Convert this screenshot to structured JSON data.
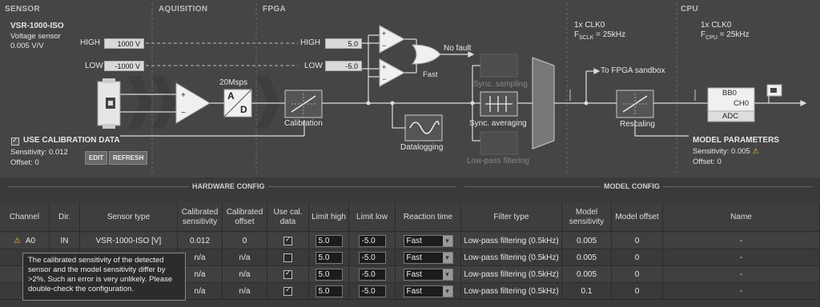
{
  "sections": {
    "sensor": "SENSOR",
    "acquisition": "AQUISITION",
    "fpga": "FPGA",
    "cpu": "CPU"
  },
  "sensor": {
    "name": "VSR-1000-ISO",
    "type": "Voltage sensor",
    "gain": "0.005 V/V",
    "high_label": "HIGH",
    "high_value": "1000 V",
    "low_label": "LOW",
    "low_value": "-1000 V"
  },
  "calibration": {
    "label": "USE CALIBRATION DATA",
    "sensitivity": "Sensitivity: 0.012",
    "offset": "Offset: 0",
    "edit": "EDIT",
    "refresh": "REFRESH"
  },
  "acq": {
    "rate": "20Msps",
    "adc_a": "A",
    "adc_d": "D"
  },
  "fpga": {
    "high_label": "HIGH",
    "high_value": "5.0",
    "low_label": "LOW",
    "low_value": "-5.0",
    "no_fault": "No fault",
    "fast": "Fast",
    "calibration": "Calibration",
    "datalogging": "Datalogging",
    "sync_sampling": "Sync. sampling",
    "sync_averaging": "Sync. averaging",
    "lowpass": "Low-pass filtering",
    "clk": "1x CLK0",
    "fs": "F",
    "fs_sub": "SCLK",
    "fs_val": " = 25kHz",
    "to_sandbox": "To FPGA sandbox",
    "rescaling": "Rescaling"
  },
  "cpu": {
    "clk": "1x CLK0",
    "f": "F",
    "f_sub": "CPU",
    "f_val": " = 25kHz",
    "bb": "BB0",
    "ch": "CH0",
    "adc": "ADC"
  },
  "model": {
    "label": "MODEL PARAMETERS",
    "sensitivity": "Sensitivity: 0.005",
    "offset": "Offset: 0"
  },
  "config": {
    "hardware": "HARDWARE CONFIG",
    "model": "MODEL CONFIG"
  },
  "table": {
    "headers": [
      "Channel",
      "Dir.",
      "Sensor type",
      "Calibrated sensitivity",
      "Calibrated offset",
      "Use cal. data",
      "Limit high",
      "Limit low",
      "Reaction time",
      "Filter type",
      "Model sensitivity",
      "Model offset",
      "Name"
    ],
    "rows": [
      {
        "channel": "A0",
        "dir": "IN",
        "sensor": "VSR-1000-ISO [V]",
        "cal_sens": "0.012",
        "cal_off": "0",
        "use_cal": true,
        "lim_high": "5.0",
        "lim_low": "-5.0",
        "reaction": "Fast",
        "filter": "Low-pass filtering (0.5kHz)",
        "model_sens": "0.005",
        "model_off": "0",
        "name": "-"
      },
      {
        "channel": "",
        "dir": "",
        "sensor": "",
        "cal_sens": "n/a",
        "cal_off": "n/a",
        "use_cal": false,
        "lim_high": "5.0",
        "lim_low": "-5.0",
        "reaction": "Fast",
        "filter": "Low-pass filtering (0.5kHz)",
        "model_sens": "0.005",
        "model_off": "0",
        "name": "-"
      },
      {
        "channel": "",
        "dir": "",
        "sensor": "",
        "cal_sens": "n/a",
        "cal_off": "n/a",
        "use_cal": true,
        "lim_high": "5.0",
        "lim_low": "-5.0",
        "reaction": "Fast",
        "filter": "Low-pass filtering (0.5kHz)",
        "model_sens": "0.005",
        "model_off": "0",
        "name": "-"
      },
      {
        "channel": "",
        "dir": "",
        "sensor": "",
        "cal_sens": "n/a",
        "cal_off": "n/a",
        "use_cal": true,
        "lim_high": "5.0",
        "lim_low": "-5.0",
        "reaction": "Fast",
        "filter": "Low-pass filtering (0.5kHz)",
        "model_sens": "0.1",
        "model_off": "0",
        "name": "-"
      }
    ]
  },
  "tooltip": "The calibrated sensitivity of the detected sensor and the model sensitivity differ by >2%. Such an error is very unlikely. Please double-check the configuration.",
  "colors": {
    "panel": "#454545",
    "table_bg": "#3a3a3a",
    "warning": "#f2c230"
  },
  "icons": [
    "warning-icon",
    "check-icon",
    "dropdown-arrow-icon",
    "sensor-icon",
    "amplifier-icon",
    "adc-icon"
  ]
}
